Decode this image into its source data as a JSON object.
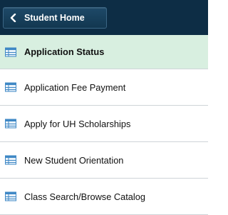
{
  "header": {
    "back_label": "Student Home",
    "icon": "chevron-left-icon"
  },
  "menu": {
    "items": [
      {
        "label": "Application Status",
        "icon": "table-icon",
        "active": true
      },
      {
        "label": "Application Fee Payment",
        "icon": "table-icon",
        "active": false
      },
      {
        "label": "Apply for UH Scholarships",
        "icon": "table-icon",
        "active": false
      },
      {
        "label": "New Student Orientation",
        "icon": "table-icon",
        "active": false
      },
      {
        "label": "Class Search/Browse Catalog",
        "icon": "table-icon",
        "active": false
      }
    ]
  },
  "colors": {
    "header_bg": "#0d2d45",
    "active_bg": "#d8efe0",
    "icon_blue": "#3f88c5"
  }
}
